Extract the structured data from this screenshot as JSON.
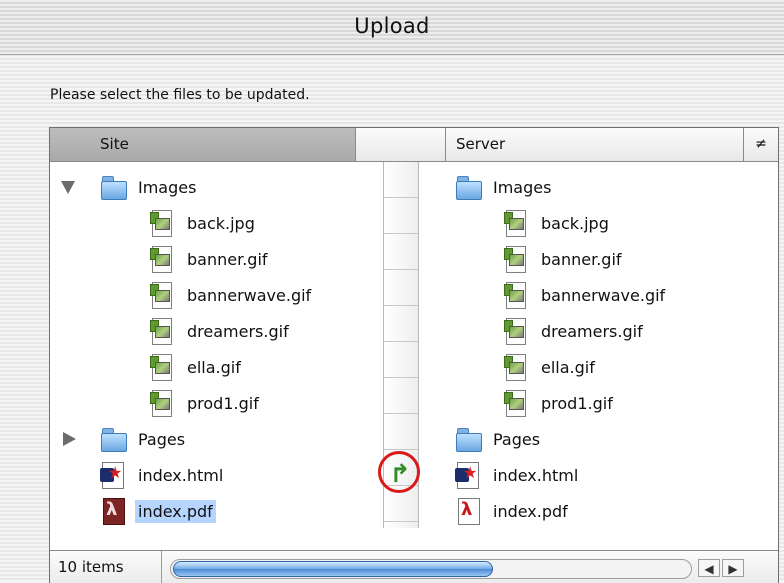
{
  "window": {
    "title": "Upload"
  },
  "instruction": "Please select the files to be updated.",
  "columns": {
    "site": "Site",
    "middle": "",
    "server": "Server",
    "sort_glyph": "≠"
  },
  "site_items": [
    {
      "label": "Images",
      "kind": "folder",
      "expanded": true
    },
    {
      "label": "back.jpg",
      "kind": "image"
    },
    {
      "label": "banner.gif",
      "kind": "image"
    },
    {
      "label": "bannerwave.gif",
      "kind": "image"
    },
    {
      "label": "dreamers.gif",
      "kind": "image"
    },
    {
      "label": "ella.gif",
      "kind": "image"
    },
    {
      "label": "prod1.gif",
      "kind": "image"
    },
    {
      "label": "Pages",
      "kind": "folder",
      "expanded": false
    },
    {
      "label": "index.html",
      "kind": "html"
    },
    {
      "label": "index.pdf",
      "kind": "pdf",
      "selected": true
    }
  ],
  "server_items": [
    {
      "label": "Images",
      "kind": "folder"
    },
    {
      "label": "back.jpg",
      "kind": "image"
    },
    {
      "label": "banner.gif",
      "kind": "image"
    },
    {
      "label": "bannerwave.gif",
      "kind": "image"
    },
    {
      "label": "dreamers.gif",
      "kind": "image"
    },
    {
      "label": "ella.gif",
      "kind": "image"
    },
    {
      "label": "prod1.gif",
      "kind": "image"
    },
    {
      "label": "Pages",
      "kind": "folder"
    },
    {
      "label": "index.html",
      "kind": "html"
    },
    {
      "label": "index.pdf",
      "kind": "pdf"
    }
  ],
  "sync_action": {
    "glyph": "↱",
    "icon": "put-arrow-icon",
    "color": "#2f8d2a",
    "highlight_color": "#d81a1a"
  },
  "status": {
    "item_count": "10 items"
  },
  "scrollbar": {
    "left_glyph": "◀",
    "right_glyph": "▶",
    "thumb_color": "#4a8ad2"
  }
}
